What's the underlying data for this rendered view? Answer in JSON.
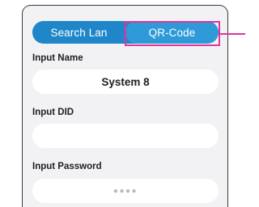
{
  "tabs": {
    "search_lan": "Search Lan",
    "qr_code": "QR-Code"
  },
  "fields": {
    "name_label": "Input Name",
    "name_value": "System 8",
    "did_label": "Input DID",
    "did_value": "",
    "password_label": "Input Password",
    "password_value": "●●●●"
  },
  "colors": {
    "tab_blue": "#1f87c9",
    "tab_selected": "#2f9ad8",
    "highlight": "#e0359d",
    "panel_bg": "#f2f2f5"
  }
}
